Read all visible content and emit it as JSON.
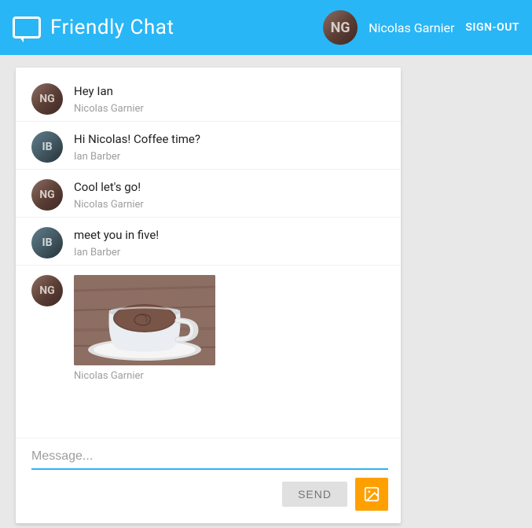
{
  "header": {
    "title": "Friendly Chat",
    "username": "Nicolas Garnier",
    "signout_label": "SIGN-OUT"
  },
  "messages": [
    {
      "id": 1,
      "text": "Hey Ian",
      "sender": "Nicolas Garnier",
      "avatar_type": "ng",
      "has_image": false
    },
    {
      "id": 2,
      "text": "Hi Nicolas! Coffee time?",
      "sender": "Ian Barber",
      "avatar_type": "ib",
      "has_image": false
    },
    {
      "id": 3,
      "text": "Cool let's go!",
      "sender": "Nicolas Garnier",
      "avatar_type": "ng",
      "has_image": false
    },
    {
      "id": 4,
      "text": "meet you in five!",
      "sender": "Ian Barber",
      "avatar_type": "ib",
      "has_image": false
    },
    {
      "id": 5,
      "text": "",
      "sender": "Nicolas Garnier",
      "avatar_type": "ng",
      "has_image": true
    }
  ],
  "input": {
    "placeholder": "Message...",
    "send_label": "SEND"
  }
}
